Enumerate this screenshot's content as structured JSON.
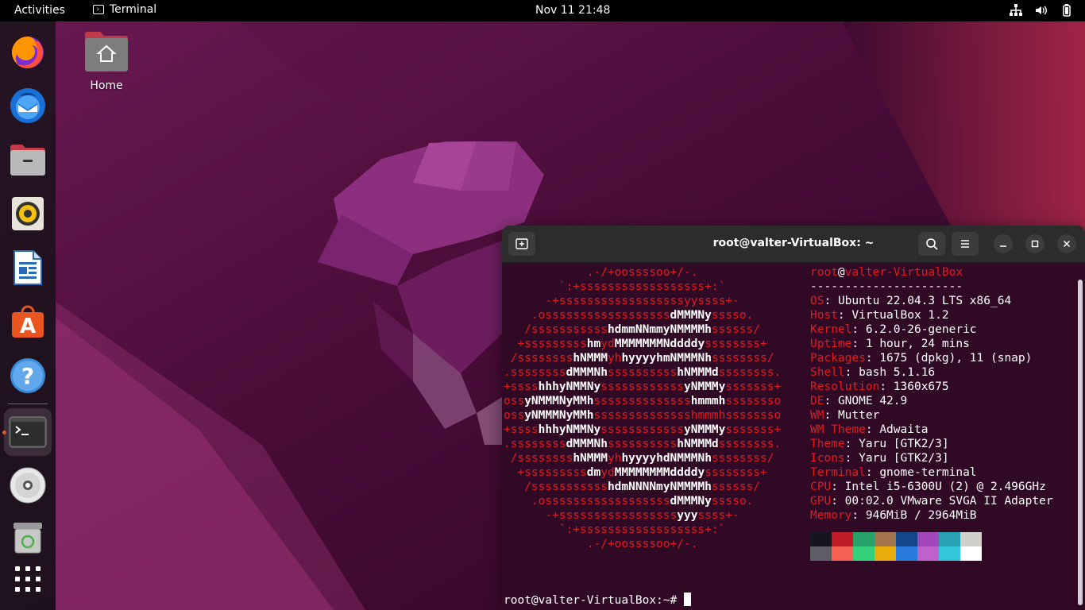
{
  "topbar": {
    "activities": "Activities",
    "app_name": "Terminal",
    "clock": "Nov 11  21:48",
    "tray_icons": [
      "network-icon",
      "volume-icon",
      "battery-icon"
    ]
  },
  "dock": {
    "items": [
      {
        "name": "firefox-icon"
      },
      {
        "name": "thunderbird-icon"
      },
      {
        "name": "files-icon"
      },
      {
        "name": "rhythmbox-icon"
      },
      {
        "name": "libreoffice-writer-icon"
      },
      {
        "name": "app-center-icon"
      },
      {
        "name": "help-icon"
      },
      {
        "name": "terminal-icon",
        "active": true
      },
      {
        "name": "disc-icon"
      },
      {
        "name": "trash-icon"
      },
      {
        "name": "show-apps-icon"
      }
    ]
  },
  "desktop": {
    "home_label": "Home"
  },
  "terminal": {
    "title": "root@valter-VirtualBox: ~",
    "logo": [
      [
        [
          "r",
          "            .-/+oossssoo+/-."
        ]
      ],
      [
        [
          "r",
          "        `:+ssssssssssssssssss+:`"
        ]
      ],
      [
        [
          "r",
          "      -+ssssssssssssssssssyyssss+-"
        ]
      ],
      [
        [
          "r",
          "    .ossssssssssssssssss"
        ],
        [
          "w",
          "dMMMNy"
        ],
        [
          "r",
          "sssso."
        ]
      ],
      [
        [
          "r",
          "   /sssssssssss"
        ],
        [
          "w",
          "hdmmNNmmyNMMMMh"
        ],
        [
          "r",
          "ssssss/"
        ]
      ],
      [
        [
          "r",
          "  +sssssssss"
        ],
        [
          "w",
          "hm"
        ],
        [
          "r",
          "yd"
        ],
        [
          "w",
          "MMMMMMMNddddy"
        ],
        [
          "r",
          "ssssssss+"
        ]
      ],
      [
        [
          "r",
          " /ssssssss"
        ],
        [
          "w",
          "hNMMM"
        ],
        [
          "r",
          "yh"
        ],
        [
          "w",
          "hyyyyhmNMMMNh"
        ],
        [
          "r",
          "ssssssss/"
        ]
      ],
      [
        [
          "r",
          ".ssssssss"
        ],
        [
          "w",
          "dMMMNh"
        ],
        [
          "r",
          "ssssssssss"
        ],
        [
          "w",
          "hNMMMd"
        ],
        [
          "r",
          "ssssssss."
        ]
      ],
      [
        [
          "r",
          "+ssss"
        ],
        [
          "w",
          "hhhyNMMNy"
        ],
        [
          "r",
          "ssssssssssss"
        ],
        [
          "w",
          "yNMMMy"
        ],
        [
          "r",
          "sssssss+"
        ]
      ],
      [
        [
          "r",
          "oss"
        ],
        [
          "w",
          "yNMMMNyMMh"
        ],
        [
          "r",
          "ssssssssssssss"
        ],
        [
          "w",
          "hmmmh"
        ],
        [
          "r",
          "ssssssso"
        ]
      ],
      [
        [
          "r",
          "oss"
        ],
        [
          "w",
          "yNMMMNyMMh"
        ],
        [
          "r",
          "sssssssssssssshmmmhssssssso"
        ]
      ],
      [
        [
          "r",
          "+ssss"
        ],
        [
          "w",
          "hhhyNMMNy"
        ],
        [
          "r",
          "ssssssssssss"
        ],
        [
          "w",
          "yNMMMy"
        ],
        [
          "r",
          "sssssss+"
        ]
      ],
      [
        [
          "r",
          ".ssssssss"
        ],
        [
          "w",
          "dMMMNh"
        ],
        [
          "r",
          "ssssssssss"
        ],
        [
          "w",
          "hNMMMd"
        ],
        [
          "r",
          "ssssssss."
        ]
      ],
      [
        [
          "r",
          " /ssssssss"
        ],
        [
          "w",
          "hNMMM"
        ],
        [
          "r",
          "yh"
        ],
        [
          "w",
          "hyyyyhdNMMMNh"
        ],
        [
          "r",
          "ssssssss/"
        ]
      ],
      [
        [
          "r",
          "  +sssssssss"
        ],
        [
          "w",
          "dm"
        ],
        [
          "r",
          "yd"
        ],
        [
          "w",
          "MMMMMMMMddddy"
        ],
        [
          "r",
          "ssssssss+"
        ]
      ],
      [
        [
          "r",
          "   /sssssssssss"
        ],
        [
          "w",
          "hdmNNNNmyNMMMMh"
        ],
        [
          "r",
          "ssssss/"
        ]
      ],
      [
        [
          "r",
          "    .ossssssssssssssssss"
        ],
        [
          "w",
          "dMMMNy"
        ],
        [
          "r",
          "sssso."
        ]
      ],
      [
        [
          "r",
          "      -+sssssssssssssssss"
        ],
        [
          "w",
          "yyy"
        ],
        [
          "r",
          "ssss+-"
        ]
      ],
      [
        [
          "r",
          "        `:+ssssssssssssssssss+:`"
        ]
      ],
      [
        [
          "r",
          "            .-/+oossssoo+/-."
        ]
      ]
    ],
    "user": "root",
    "host": "valter-VirtualBox",
    "separator": "----------------------",
    "info": [
      {
        "key": "OS",
        "value": "Ubuntu 22.04.3 LTS x86_64"
      },
      {
        "key": "Host",
        "value": "VirtualBox 1.2"
      },
      {
        "key": "Kernel",
        "value": "6.2.0-26-generic"
      },
      {
        "key": "Uptime",
        "value": "1 hour, 24 mins"
      },
      {
        "key": "Packages",
        "value": "1675 (dpkg), 11 (snap)"
      },
      {
        "key": "Shell",
        "value": "bash 5.1.16"
      },
      {
        "key": "Resolution",
        "value": "1360x675"
      },
      {
        "key": "DE",
        "value": "GNOME 42.9"
      },
      {
        "key": "WM",
        "value": "Mutter"
      },
      {
        "key": "WM Theme",
        "value": "Adwaita"
      },
      {
        "key": "Theme",
        "value": "Yaru [GTK2/3]"
      },
      {
        "key": "Icons",
        "value": "Yaru [GTK2/3]"
      },
      {
        "key": "Terminal",
        "value": "gnome-terminal"
      },
      {
        "key": "CPU",
        "value": "Intel i5-6300U (2) @ 2.496GHz"
      },
      {
        "key": "GPU",
        "value": "00:02.0 VMware SVGA II Adapter"
      },
      {
        "key": "Memory",
        "value": "946MiB / 2964MiB"
      }
    ],
    "palette_top": [
      "#171421",
      "#c01c28",
      "#26a269",
      "#a2734c",
      "#12488b",
      "#a347ba",
      "#2aa1b3",
      "#d0cfcc"
    ],
    "palette_bottom": [
      "#5e5c64",
      "#f66151",
      "#33d17a",
      "#e9ad0c",
      "#2a7bde",
      "#c061cb",
      "#33c7de",
      "#ffffff"
    ],
    "prompt": "root@valter-VirtualBox:~# "
  }
}
